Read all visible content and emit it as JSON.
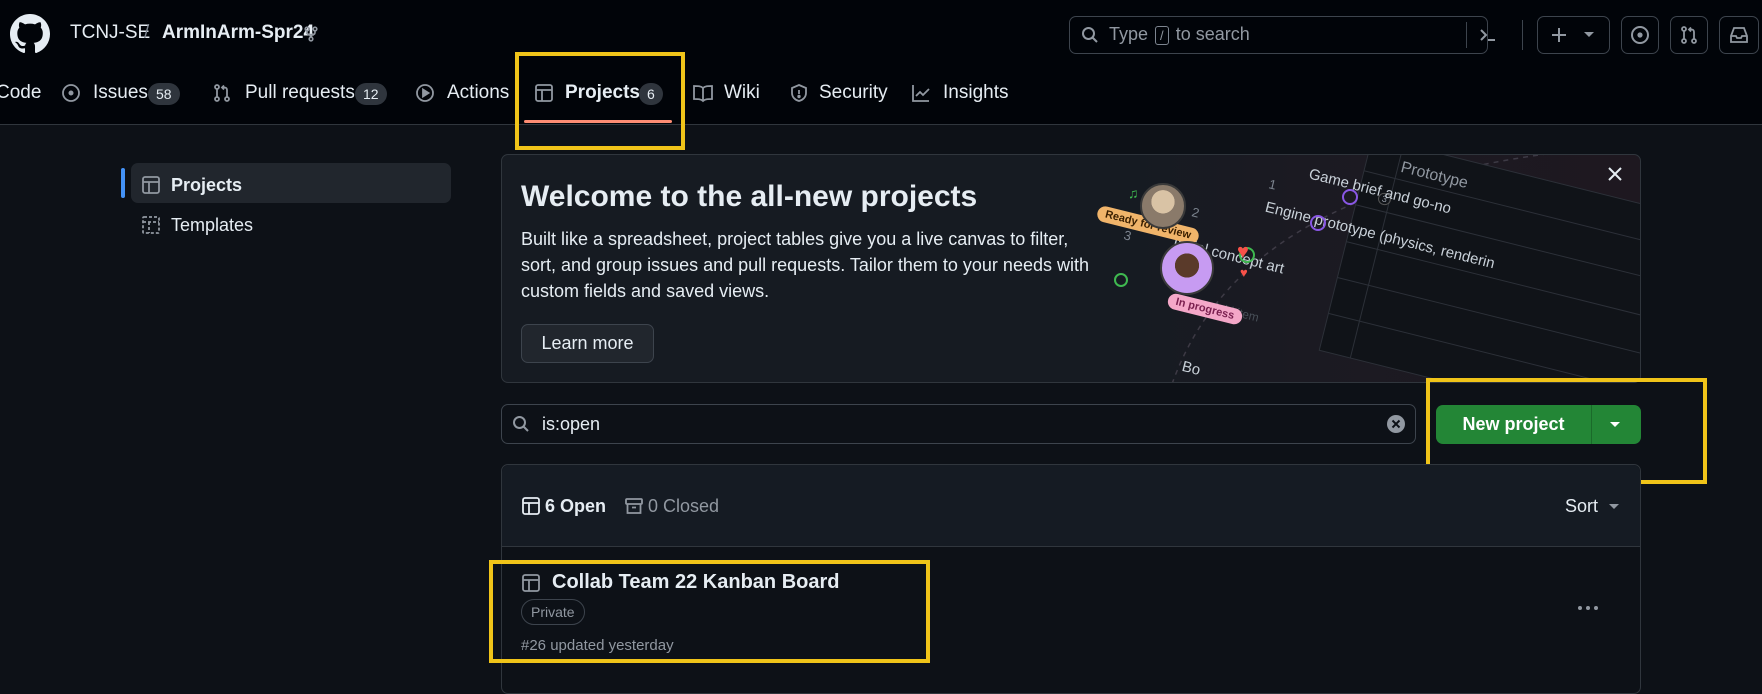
{
  "header": {
    "owner": "TCNJ-SE",
    "separator": "/",
    "repo": "ArmInArm-Spr24",
    "search": {
      "prefix": "Type",
      "key": "/",
      "suffix": "to search"
    }
  },
  "tabs": [
    {
      "label": "Code",
      "icon": "code-icon"
    },
    {
      "label": "Issues",
      "count": "58",
      "icon": "issue-icon"
    },
    {
      "label": "Pull requests",
      "count": "12",
      "icon": "pull-request-icon"
    },
    {
      "label": "Actions",
      "icon": "play-icon"
    },
    {
      "label": "Projects",
      "count": "6",
      "icon": "table-icon",
      "selected": true
    },
    {
      "label": "Wiki",
      "icon": "book-icon"
    },
    {
      "label": "Security",
      "icon": "shield-icon"
    },
    {
      "label": "Insights",
      "icon": "graph-icon"
    }
  ],
  "sidebar": {
    "items": [
      {
        "label": "Projects",
        "icon": "table-icon",
        "selected": true
      },
      {
        "label": "Templates",
        "icon": "template-icon"
      }
    ]
  },
  "banner": {
    "title": "Welcome to the all-new projects",
    "description": "Built like a spreadsheet, project tables give you a live canvas to filter, sort, and group issues and pull requests. Tailor them to your needs with custom fields and saved views.",
    "learn_more": "Learn more",
    "illustration": {
      "prototype": "Prototype",
      "row1_num": "1",
      "row1": "Game brief and go-no",
      "row2_num": "2",
      "row2": "Engine prototype (physics, renderin",
      "row3_num": "3",
      "row3": "Initial concept art",
      "add_item": "Add item",
      "ready_tag": "Ready for review",
      "progress_tag": "In progress",
      "count_tag": "3",
      "bottom": "Bo"
    }
  },
  "filter": {
    "value": "is:open"
  },
  "new_project": {
    "label": "New project"
  },
  "list": {
    "open_count": "6 Open",
    "closed_count": "0 Closed",
    "sort": "Sort",
    "projects": [
      {
        "title": "Collab Team 22 Kanban Board",
        "visibility": "Private",
        "meta": "#26 updated yesterday"
      }
    ]
  },
  "colors": {
    "accent": "#4493f8",
    "tab_underline": "#fd8c73",
    "highlight": "#f0c419",
    "primary": "#238636"
  }
}
